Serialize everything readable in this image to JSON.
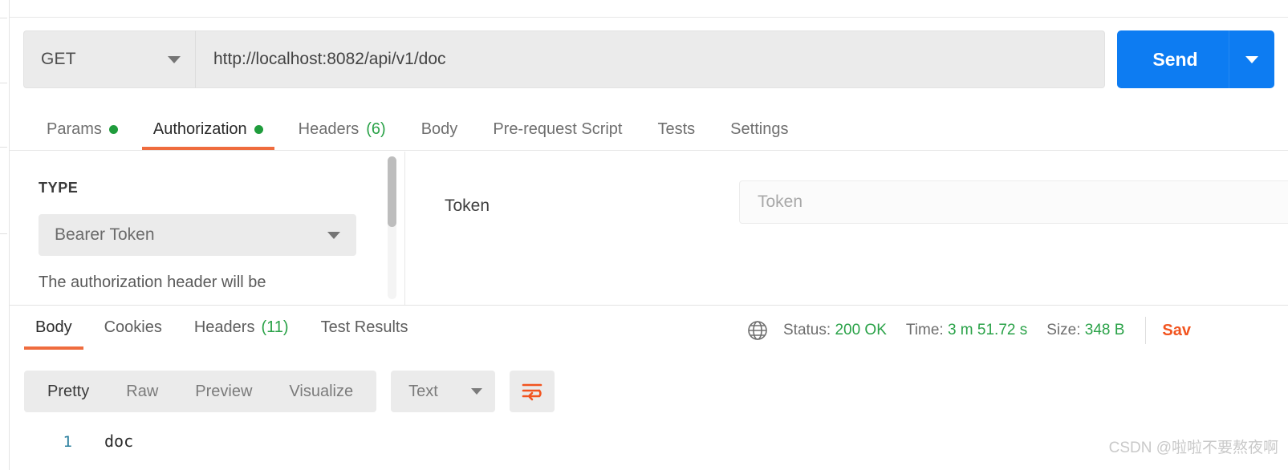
{
  "request": {
    "method": "GET",
    "url": "http://localhost:8082/api/v1/doc",
    "send_label": "Send",
    "tabs": [
      {
        "label": "Params",
        "indicator": "dot"
      },
      {
        "label": "Authorization",
        "indicator": "dot"
      },
      {
        "label": "Headers",
        "count": "(6)"
      },
      {
        "label": "Body"
      },
      {
        "label": "Pre-request Script"
      },
      {
        "label": "Tests"
      },
      {
        "label": "Settings"
      }
    ]
  },
  "authorization": {
    "type_label": "TYPE",
    "type_value": "Bearer Token",
    "help_text": "The authorization header will be",
    "token_label": "Token",
    "token_value": "",
    "token_placeholder": "Token"
  },
  "response": {
    "tabs": [
      {
        "label": "Body"
      },
      {
        "label": "Cookies"
      },
      {
        "label": "Headers",
        "count": "(11)"
      },
      {
        "label": "Test Results"
      }
    ],
    "status_label": "Status:",
    "status_value": "200 OK",
    "time_label": "Time:",
    "time_value": "3 m 51.72 s",
    "size_label": "Size:",
    "size_value": "348 B",
    "save_label": "Sav",
    "view_modes": [
      "Pretty",
      "Raw",
      "Preview",
      "Visualize"
    ],
    "format_value": "Text",
    "lines": [
      {
        "number": "1",
        "text": "doc"
      }
    ]
  },
  "colors": {
    "accent_orange": "#ef6c3e",
    "send_blue": "#0d7cf2",
    "status_green": "#2aa248",
    "save_orange": "#f2541f",
    "line_number": "#2a7f9e"
  },
  "watermark": "CSDN @啦啦不要熬夜啊"
}
